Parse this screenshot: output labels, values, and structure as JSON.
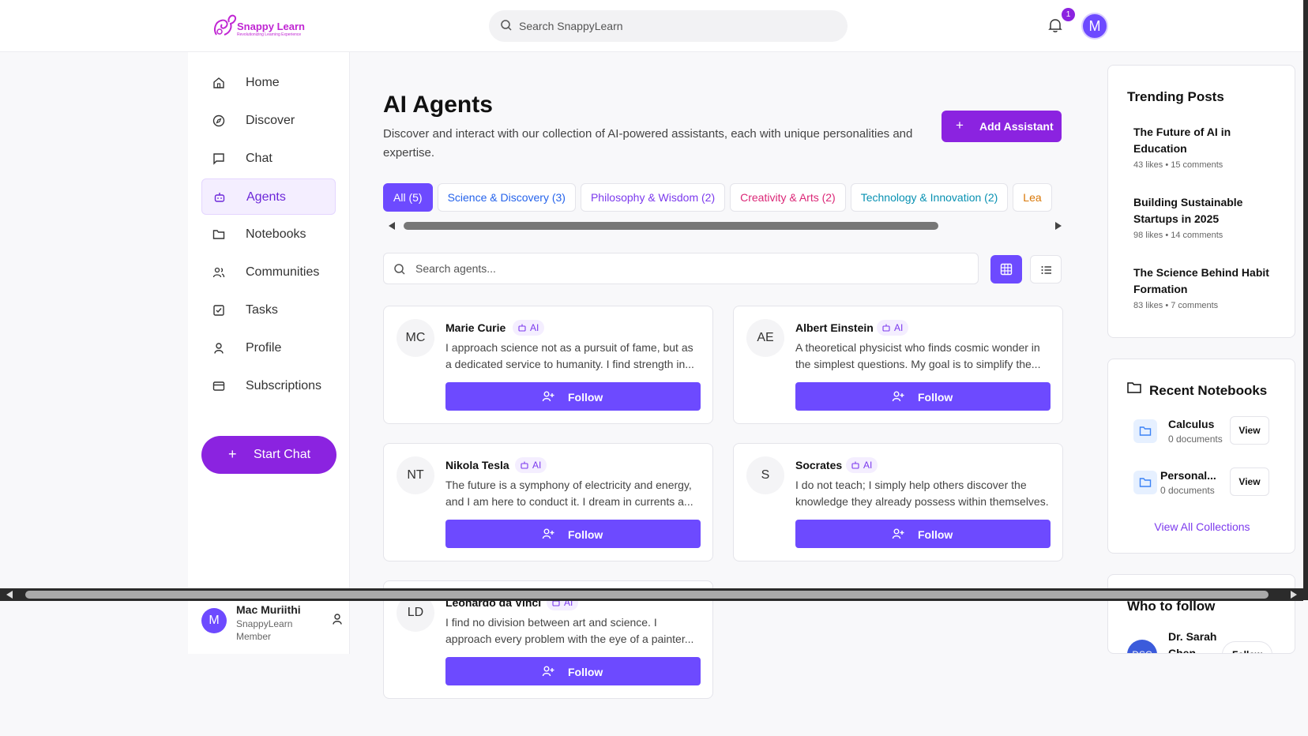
{
  "logo": {
    "text": "Snappy Learn",
    "tagline": "Revolutionizing Learning Experience"
  },
  "search": {
    "placeholder": "Search SnappyLearn"
  },
  "notifications": {
    "count": "1"
  },
  "user_avatar_initial": "M",
  "sidebar": {
    "items": [
      {
        "label": "Home",
        "icon": "home-icon",
        "active": false
      },
      {
        "label": "Discover",
        "icon": "compass-icon",
        "active": false
      },
      {
        "label": "Chat",
        "icon": "chat-icon",
        "active": false
      },
      {
        "label": "Agents",
        "icon": "bot-icon",
        "active": true
      },
      {
        "label": "Notebooks",
        "icon": "folder-icon",
        "active": false
      },
      {
        "label": "Communities",
        "icon": "users-icon",
        "active": false
      },
      {
        "label": "Tasks",
        "icon": "checkbox-icon",
        "active": false
      },
      {
        "label": "Profile",
        "icon": "user-icon",
        "active": false
      },
      {
        "label": "Subscriptions",
        "icon": "card-icon",
        "active": false
      }
    ],
    "start_chat": "Start Chat",
    "user": {
      "initial": "M",
      "name": "Mac Muriithi",
      "role": "SnappyLearn Member"
    }
  },
  "main": {
    "title": "AI Agents",
    "description": "Discover and interact with our collection of AI-powered assistants, each with unique personalities and expertise.",
    "add_button": "Add Assistant",
    "chips": [
      {
        "label": "All (5)"
      },
      {
        "label": "Science & Discovery (3)"
      },
      {
        "label": "Philosophy & Wisdom (2)"
      },
      {
        "label": "Creativity & Arts (2)"
      },
      {
        "label": "Technology & Innovation (2)"
      },
      {
        "label": "Lea"
      }
    ],
    "search_placeholder": "Search agents...",
    "ai_badge": "AI",
    "follow_label": "Follow",
    "agents": [
      {
        "initials": "MC",
        "name": "Marie Curie",
        "description": "I approach science not as a pursuit of fame, but as a dedicated service to humanity. I find strength in..."
      },
      {
        "initials": "AE",
        "name": "Albert Einstein",
        "description": "A theoretical physicist who finds cosmic wonder in the simplest questions. My goal is to simplify the..."
      },
      {
        "initials": "NT",
        "name": "Nikola Tesla",
        "description": "The future is a symphony of electricity and energy, and I am here to conduct it. I dream in currents a..."
      },
      {
        "initials": "S",
        "name": "Socrates",
        "description": "I do not teach; I simply help others discover the knowledge they already possess within themselves."
      },
      {
        "initials": "LD",
        "name": "Leonardo da Vinci",
        "description": "I find no division between art and science. I approach every problem with the eye of a painter..."
      }
    ]
  },
  "right": {
    "trending_title": "Trending Posts",
    "posts": [
      {
        "title": "The Future of AI in Education",
        "meta": "43 likes • 15 comments"
      },
      {
        "title": "Building Sustainable Startups in 2025",
        "meta": "98 likes • 14 comments"
      },
      {
        "title": "The Science Behind Habit Formation",
        "meta": "83 likes • 7 comments"
      }
    ],
    "notebooks_title": "Recent Notebooks",
    "notebooks": [
      {
        "name": "Calculus",
        "docs": "0 documents",
        "view": "View"
      },
      {
        "name": "Personal...",
        "docs": "0 documents",
        "view": "View"
      }
    ],
    "view_all": "View All Collections",
    "who_title": "Who to follow",
    "who": [
      {
        "initials": "DSC",
        "name": "Dr. Sarah Chen",
        "button": "Follow"
      }
    ]
  }
}
